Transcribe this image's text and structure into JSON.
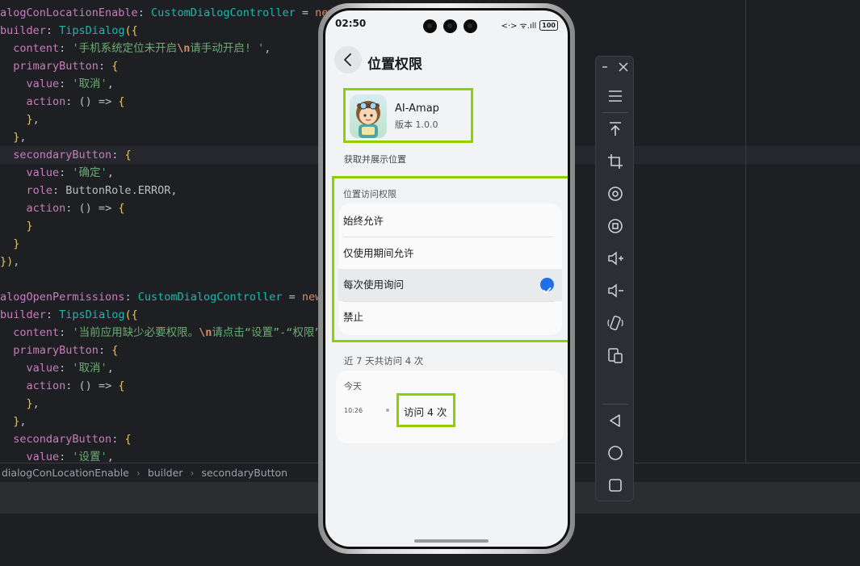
{
  "editor": {
    "lines": [
      [
        [
          "c-field",
          "alogConLocationEnable"
        ],
        [
          "c-plain",
          ": "
        ],
        [
          "c-type",
          "CustomDialogController"
        ],
        [
          "c-plain",
          " = "
        ],
        [
          "c-kw",
          "new"
        ]
      ],
      [
        [
          "c-field",
          "builder"
        ],
        [
          "c-plain",
          ": "
        ],
        [
          "c-type",
          "TipsDialog"
        ],
        [
          "c-brace",
          "({"
        ]
      ],
      [
        [
          "c-plain",
          "  "
        ],
        [
          "c-field",
          "content"
        ],
        [
          "c-plain",
          ": "
        ],
        [
          "c-str",
          "'手机系统定位未开启"
        ],
        [
          "c-esc",
          "\\n"
        ],
        [
          "c-str",
          "请手动开启! '"
        ],
        [
          "c-plain",
          ","
        ]
      ],
      [
        [
          "c-plain",
          "  "
        ],
        [
          "c-field",
          "primaryButton"
        ],
        [
          "c-plain",
          ": "
        ],
        [
          "c-brace",
          "{"
        ]
      ],
      [
        [
          "c-plain",
          "    "
        ],
        [
          "c-field",
          "value"
        ],
        [
          "c-plain",
          ": "
        ],
        [
          "c-str",
          "'取消'"
        ],
        [
          "c-plain",
          ","
        ]
      ],
      [
        [
          "c-plain",
          "    "
        ],
        [
          "c-field",
          "action"
        ],
        [
          "c-plain",
          ": () => "
        ],
        [
          "c-brace",
          "{"
        ]
      ],
      [
        [
          "c-plain",
          "    "
        ],
        [
          "c-brace",
          "}"
        ],
        [
          "c-plain",
          ","
        ]
      ],
      [
        [
          "c-plain",
          "  "
        ],
        [
          "c-brace",
          "}"
        ],
        [
          "c-plain",
          ","
        ]
      ],
      [
        [
          "c-plain",
          "  "
        ],
        [
          "c-field",
          "secondaryButton"
        ],
        [
          "c-plain",
          ": "
        ],
        [
          "c-brace",
          "{"
        ]
      ],
      [
        [
          "c-plain",
          "    "
        ],
        [
          "c-field",
          "value"
        ],
        [
          "c-plain",
          ": "
        ],
        [
          "c-str",
          "'确定'"
        ],
        [
          "c-plain",
          ","
        ]
      ],
      [
        [
          "c-plain",
          "    "
        ],
        [
          "c-field",
          "role"
        ],
        [
          "c-plain",
          ": ButtonRole.ERROR,"
        ]
      ],
      [
        [
          "c-plain",
          "    "
        ],
        [
          "c-field",
          "action"
        ],
        [
          "c-plain",
          ": () => "
        ],
        [
          "c-brace",
          "{"
        ]
      ],
      [
        [
          "c-plain",
          "    "
        ],
        [
          "c-brace",
          "}"
        ]
      ],
      [
        [
          "c-plain",
          "  "
        ],
        [
          "c-brace",
          "}"
        ]
      ],
      [
        [
          "c-brace",
          "})"
        ],
        [
          "c-plain",
          ","
        ]
      ],
      [
        [
          "c-plain",
          ""
        ]
      ],
      [
        [
          "c-field",
          "alogOpenPermissions"
        ],
        [
          "c-plain",
          ": "
        ],
        [
          "c-type",
          "CustomDialogController"
        ],
        [
          "c-plain",
          " = "
        ],
        [
          "c-kw",
          "new"
        ]
      ],
      [
        [
          "c-field",
          "builder"
        ],
        [
          "c-plain",
          ": "
        ],
        [
          "c-type",
          "TipsDialog"
        ],
        [
          "c-brace",
          "({"
        ]
      ],
      [
        [
          "c-plain",
          "  "
        ],
        [
          "c-field",
          "content"
        ],
        [
          "c-plain",
          ": "
        ],
        [
          "c-str",
          "'当前应用缺少必要权限。"
        ],
        [
          "c-esc",
          "\\n"
        ],
        [
          "c-str",
          "请点击“设置”-“权限”-打"
        ]
      ],
      [
        [
          "c-plain",
          "  "
        ],
        [
          "c-field",
          "primaryButton"
        ],
        [
          "c-plain",
          ": "
        ],
        [
          "c-brace",
          "{"
        ]
      ],
      [
        [
          "c-plain",
          "    "
        ],
        [
          "c-field",
          "value"
        ],
        [
          "c-plain",
          ": "
        ],
        [
          "c-str",
          "'取消'"
        ],
        [
          "c-plain",
          ","
        ]
      ],
      [
        [
          "c-plain",
          "    "
        ],
        [
          "c-field",
          "action"
        ],
        [
          "c-plain",
          ": () => "
        ],
        [
          "c-brace",
          "{"
        ]
      ],
      [
        [
          "c-plain",
          "    "
        ],
        [
          "c-brace",
          "}"
        ],
        [
          "c-plain",
          ","
        ]
      ],
      [
        [
          "c-plain",
          "  "
        ],
        [
          "c-brace",
          "}"
        ],
        [
          "c-plain",
          ","
        ]
      ],
      [
        [
          "c-plain",
          "  "
        ],
        [
          "c-field",
          "secondaryButton"
        ],
        [
          "c-plain",
          ": "
        ],
        [
          "c-brace",
          "{"
        ]
      ],
      [
        [
          "c-plain",
          "    "
        ],
        [
          "c-field",
          "value"
        ],
        [
          "c-plain",
          ": "
        ],
        [
          "c-str",
          "'设置'"
        ],
        [
          "c-plain",
          ","
        ]
      ]
    ],
    "breadcrumb": [
      "dialogConLocationEnable",
      "builder",
      "secondaryButton"
    ],
    "breadcrumb_separator": "›"
  },
  "phone": {
    "status": {
      "time": "02:50",
      "signal": "<·>  ᯤ.ıll",
      "battery": "100"
    },
    "title": "位置权限",
    "app": {
      "name": "AI-Amap",
      "version": "版本 1.0.0"
    },
    "purpose": "获取并展示位置",
    "permission": {
      "header": "位置访问权限",
      "options": [
        "始终允许",
        "仅使用期间允许",
        "每次使用询问",
        "禁止"
      ],
      "selected_index": 2
    },
    "history": {
      "title": "近 7 天共访问 4 次",
      "day": "今天",
      "time": "10:26",
      "count": "访问 4 次"
    }
  },
  "toolbar": {
    "buttons": [
      "minimize-icon",
      "close-icon",
      "menu-icon",
      "pin-top-icon",
      "crop-icon",
      "rotate-icon",
      "screenshot-icon",
      "volume-up-icon",
      "volume-down-icon",
      "shake-icon",
      "multi-device-icon",
      "back-icon",
      "home-icon",
      "recents-icon"
    ]
  },
  "colors": {
    "highlight": "#8bd100",
    "accent": "#1f6fe8"
  }
}
